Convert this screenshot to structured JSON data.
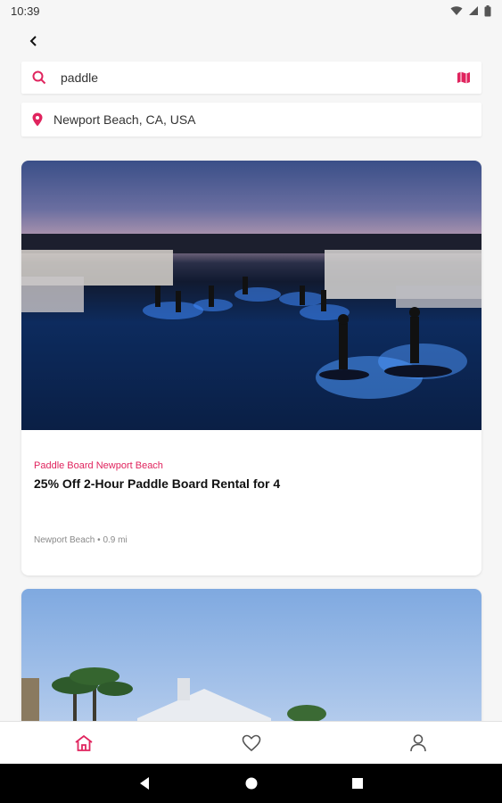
{
  "status_bar": {
    "time": "10:39"
  },
  "search": {
    "query": "paddle",
    "icon": "search-icon",
    "map_icon": "map-icon"
  },
  "location": {
    "text": "Newport Beach, CA, USA",
    "icon": "location-pin-icon"
  },
  "deals": [
    {
      "merchant": "Paddle Board Newport Beach",
      "title": "25% Off 2-Hour Paddle Board Rental for 4",
      "location": "Newport Beach",
      "distance": "0.9 mi"
    }
  ],
  "bottom_nav": [
    {
      "icon": "home-icon",
      "active": true
    },
    {
      "icon": "heart-icon",
      "active": false
    },
    {
      "icon": "profile-icon",
      "active": false
    }
  ],
  "colors": {
    "accent": "#e0245e",
    "muted": "#8a8a8a"
  }
}
